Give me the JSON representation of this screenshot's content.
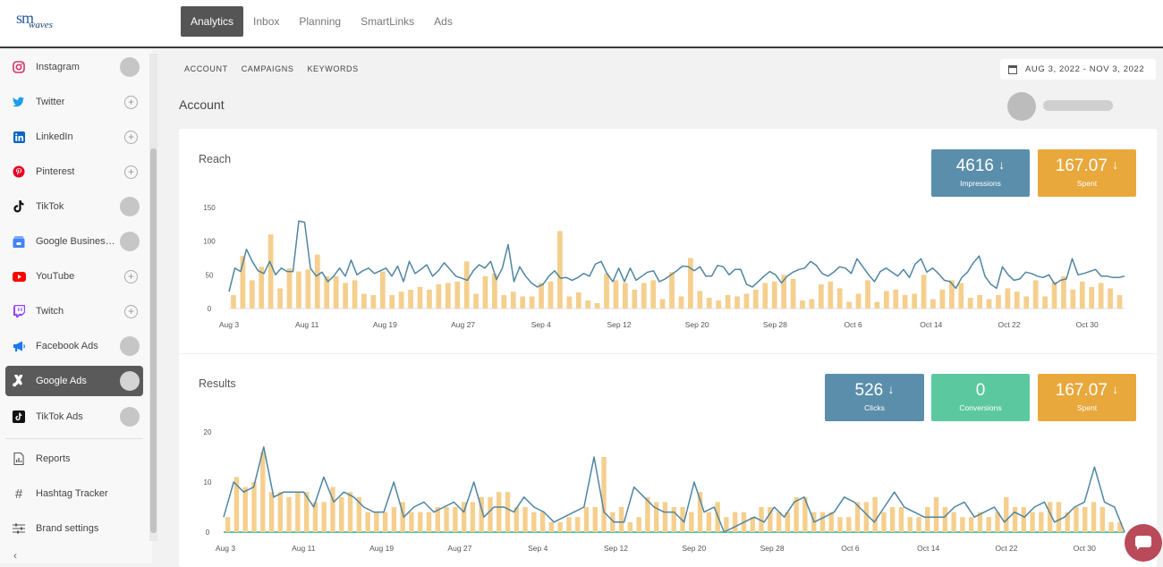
{
  "app": {
    "logo_main": "sm",
    "logo_sub": "waves"
  },
  "nav": [
    "Analytics",
    "Inbox",
    "Planning",
    "SmartLinks",
    "Ads"
  ],
  "sidebar": {
    "items": [
      {
        "label": "Instagram",
        "icon": "instagram-icon",
        "status": "connected"
      },
      {
        "label": "Twitter",
        "icon": "twitter-icon",
        "status": "add"
      },
      {
        "label": "LinkedIn",
        "icon": "linkedin-icon",
        "status": "add"
      },
      {
        "label": "Pinterest",
        "icon": "pinterest-icon",
        "status": "add"
      },
      {
        "label": "TikTok",
        "icon": "tiktok-icon",
        "status": "connected"
      },
      {
        "label": "Google Business ...",
        "icon": "google-business-icon",
        "status": "connected"
      },
      {
        "label": "YouTube",
        "icon": "youtube-icon",
        "status": "add"
      },
      {
        "label": "Twitch",
        "icon": "twitch-icon",
        "status": "add"
      },
      {
        "label": "Facebook Ads",
        "icon": "megaphone-icon",
        "status": "connected"
      },
      {
        "label": "Google Ads",
        "icon": "google-ads-icon",
        "status": "connected",
        "active": true
      },
      {
        "label": "TikTok Ads",
        "icon": "tiktok-ads-icon",
        "status": "connected"
      }
    ],
    "tools": [
      {
        "label": "Reports",
        "icon": "report-icon"
      },
      {
        "label": "Hashtag Tracker",
        "icon": "hashtag-icon"
      },
      {
        "label": "Brand settings",
        "icon": "sliders-icon"
      }
    ],
    "collapse_icon": "chevron-left-icon"
  },
  "subnav": [
    "ACCOUNT",
    "CAMPAIGNS",
    "KEYWORDS"
  ],
  "date_range": "AUG 3, 2022 - NOV 3, 2022",
  "page_title": "Account",
  "colors": {
    "impressions": "#5a8eaa",
    "spent": "#e9a83c",
    "conversions": "#5cc8a0",
    "bar": "#f5cf8e",
    "line": "#4f85a3",
    "active_nav": "#555555"
  },
  "reach": {
    "title": "Reach",
    "kpis": [
      {
        "value": "4616",
        "label": "Impressions",
        "color": "#5a8eaa",
        "trend": "down"
      },
      {
        "value": "167.07",
        "label": "Spent",
        "color": "#e9a83c",
        "trend": "down"
      }
    ]
  },
  "results": {
    "title": "Results",
    "kpis": [
      {
        "value": "526",
        "label": "Clicks",
        "color": "#5a8eaa",
        "trend": "down"
      },
      {
        "value": "0",
        "label": "Conversions",
        "color": "#5cc8a0",
        "trend": "none"
      },
      {
        "value": "167.07",
        "label": "Spent",
        "color": "#e9a83c",
        "trend": "down"
      }
    ]
  },
  "chart_data": [
    {
      "type": "bar",
      "title": "Reach",
      "x_ticks": [
        "Aug 3",
        "Aug 11",
        "Aug 19",
        "Aug 27",
        "Sep 4",
        "Sep 12",
        "Sep 20",
        "Sep 28",
        "Oct 6",
        "Oct 14",
        "Oct 22",
        "Oct 30"
      ],
      "y_ticks": [
        "0",
        "50",
        "100",
        "150"
      ],
      "ylim": [
        0,
        150
      ],
      "series": [
        {
          "kind": "bar",
          "values": [
            20,
            78,
            42,
            62,
            110,
            30,
            60,
            55,
            58,
            80,
            48,
            48,
            38,
            42,
            22,
            20,
            55,
            20,
            25,
            28,
            32,
            28,
            36,
            38,
            40,
            70,
            22,
            48,
            52,
            20,
            25,
            18,
            18,
            38,
            40,
            115,
            18,
            24,
            12,
            8,
            52,
            42,
            38,
            28,
            38,
            42,
            14,
            54,
            18,
            75,
            26,
            16,
            12,
            20,
            18,
            22,
            28,
            38,
            40,
            50,
            44,
            12,
            14,
            36,
            40,
            30,
            10,
            22,
            42,
            10,
            26,
            28,
            20,
            22,
            50,
            14,
            28,
            42,
            38,
            16,
            20,
            14,
            20,
            30,
            25,
            18,
            42,
            18,
            40,
            48,
            28,
            40,
            32,
            38,
            30,
            20
          ],
          "color": "#f5cf8e"
        },
        {
          "kind": "line",
          "values": [
            25,
            60,
            55,
            88,
            70,
            56,
            52,
            70,
            50,
            60,
            55,
            55,
            130,
            128,
            60,
            48,
            54,
            40,
            48,
            60,
            48,
            72,
            50,
            56,
            60,
            52,
            56,
            60,
            48,
            63,
            40,
            70,
            52,
            58,
            65,
            48,
            56,
            68,
            58,
            48,
            45,
            42,
            56,
            65,
            60,
            70,
            43,
            60,
            95,
            40,
            62,
            48,
            38,
            32,
            36,
            48,
            56,
            45,
            46,
            42,
            46,
            52,
            48,
            66,
            70,
            52,
            40,
            60,
            40,
            60,
            42,
            48,
            54,
            56,
            40,
            44,
            50,
            56,
            63,
            62,
            56,
            62,
            48,
            48,
            64,
            62,
            50,
            58,
            58,
            36,
            32,
            40,
            48,
            55,
            50,
            38,
            48,
            54,
            58,
            60,
            70,
            64,
            52,
            48,
            54,
            62,
            60,
            52,
            74,
            62,
            50,
            40,
            55,
            60,
            54,
            48,
            58,
            46,
            66,
            74,
            54,
            60,
            52,
            42,
            40,
            30,
            46,
            54,
            68,
            78,
            48,
            36,
            30,
            62,
            50,
            42,
            44,
            54,
            52,
            48,
            46,
            50,
            36,
            42,
            44,
            74,
            50,
            52,
            55,
            58,
            48,
            48,
            46,
            46,
            48
          ]
        }
      ]
    },
    {
      "type": "bar",
      "title": "Results",
      "x_ticks": [
        "Aug 3",
        "Aug 11",
        "Aug 19",
        "Aug 27",
        "Sep 4",
        "Sep 12",
        "Sep 20",
        "Sep 28",
        "Oct 6",
        "Oct 14",
        "Oct 22",
        "Oct 30"
      ],
      "y_ticks": [
        "0",
        "10",
        "20"
      ],
      "ylim": [
        0,
        20
      ],
      "series": [
        {
          "kind": "bar",
          "values": [
            3,
            11,
            9,
            10,
            16,
            8,
            8,
            7,
            8,
            8,
            6,
            6,
            9,
            7,
            8,
            7,
            4,
            4,
            4,
            5,
            6,
            4,
            4,
            4,
            5,
            5,
            5,
            6,
            6,
            7,
            7,
            8,
            8,
            5,
            5,
            4,
            4,
            2,
            2,
            3,
            3,
            5,
            5,
            15,
            4,
            5,
            2,
            3,
            7,
            6,
            6,
            5,
            5,
            4,
            8,
            4,
            6,
            3,
            4,
            4,
            3,
            5,
            5,
            4,
            4,
            7,
            7,
            4,
            4,
            4,
            3,
            3,
            6,
            6,
            7,
            4,
            5,
            5,
            3,
            3,
            5,
            7,
            5,
            4,
            3,
            3,
            4,
            3,
            4,
            7,
            5,
            5,
            4,
            4,
            6,
            6,
            4,
            5,
            5,
            6,
            5,
            2,
            2
          ],
          "color": "#f5cf8e"
        },
        {
          "kind": "line",
          "values": [
            3,
            10,
            8,
            9,
            17,
            7,
            8,
            8,
            8,
            5,
            11,
            6,
            8,
            7,
            5,
            4,
            4,
            10,
            3,
            5,
            6,
            4,
            5,
            6,
            4,
            10,
            3,
            5,
            5,
            4,
            7,
            5,
            4,
            2,
            3,
            4,
            5,
            15,
            4,
            2,
            2,
            9,
            7,
            5,
            4,
            4,
            2,
            10,
            4,
            5,
            0,
            1,
            2,
            3,
            2,
            5,
            3,
            6,
            7,
            2,
            3,
            4,
            7,
            6,
            4,
            2,
            5,
            8,
            5,
            4,
            3,
            3,
            3,
            5,
            6,
            3,
            4,
            5,
            2,
            4,
            3,
            5,
            6,
            2,
            3,
            5,
            6,
            13,
            6,
            5,
            0
          ]
        }
      ]
    }
  ]
}
